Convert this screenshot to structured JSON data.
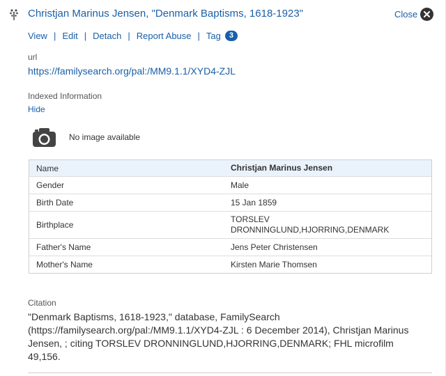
{
  "header": {
    "title": "Christjan Marinus Jensen, \"Denmark Baptisms, 1618-1923\"",
    "close_label": "Close",
    "logo_icon": "family-tree-icon",
    "close_icon": "close-circle-icon"
  },
  "actions": {
    "view": "View",
    "edit": "Edit",
    "detach": "Detach",
    "report_abuse": "Report Abuse",
    "tag": "Tag",
    "tag_count": "3",
    "separator": "|"
  },
  "url": {
    "label": "url",
    "value": "https://familysearch.org/pal:/MM9.1.1/XYD4-ZJL"
  },
  "indexed": {
    "label": "Indexed Information",
    "toggle": "Hide",
    "no_image_text": "No image available",
    "camera_icon": "camera-icon"
  },
  "record_table": [
    {
      "field": "Name",
      "value": "Christjan Marinus Jensen"
    },
    {
      "field": "Gender",
      "value": "Male"
    },
    {
      "field": "Birth Date",
      "value": "15 Jan 1859"
    },
    {
      "field": "Birthplace",
      "value": "TORSLEV DRONNINGLUND,HJORRING,DENMARK"
    },
    {
      "field": "Father's Name",
      "value": "Jens Peter Christensen"
    },
    {
      "field": "Mother's Name",
      "value": "Kirsten Marie Thomsen"
    }
  ],
  "citation": {
    "label": "Citation",
    "text": "\"Denmark Baptisms, 1618-1923,\" database, FamilySearch (https://familysearch.org/pal:/MM9.1.1/XYD4-ZJL : 6 December 2014), Christjan Marinus Jensen, ; citing TORSLEV DRONNINGLUND,HJORRING,DENMARK; FHL microfilm 49,156."
  },
  "colors": {
    "link": "#1a5fa8",
    "badge": "#1a5fa8",
    "table_header_bg": "#eaf3fb"
  }
}
